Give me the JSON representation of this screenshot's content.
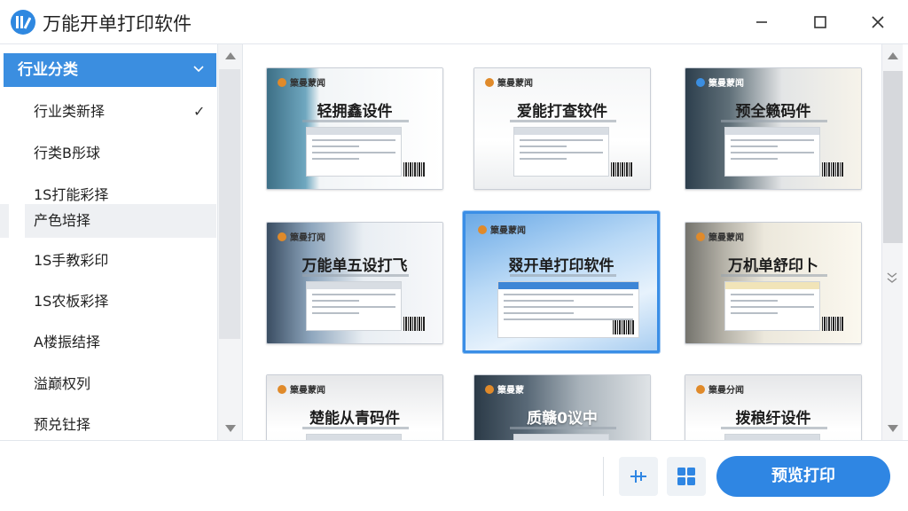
{
  "window": {
    "title": "万能开单打印软件"
  },
  "sidebar": {
    "header": "行业分类",
    "items": [
      {
        "label": "行业类新择"
      },
      {
        "label": "行类B彤球"
      },
      {
        "label": "1S打能彩择"
      },
      {
        "label": "产色培择"
      },
      {
        "label": "1S手教彩印"
      },
      {
        "label": "1S农板彩择"
      },
      {
        "label": "A楼振结择"
      },
      {
        "label": "溢巅权列"
      },
      {
        "label": "预兑钍择"
      }
    ],
    "checked_mark": "✓"
  },
  "templates": [
    {
      "brand": "篥曼蒙闻",
      "title": "轻拥鑫设件"
    },
    {
      "brand": "篥曼蒙闻",
      "title": "爱能打查铰件"
    },
    {
      "brand": "篥曼蒙闻",
      "title": "预全籁码件"
    },
    {
      "brand": "篥曼打闻",
      "title": "万能单五设打飞"
    },
    {
      "brand": "篥曼蒙闻",
      "title": "叕开单打印软件"
    },
    {
      "brand": "篥曼蒙闻",
      "title": "万机单舒印卜"
    },
    {
      "brand": "篥曼蒙闻",
      "title": "楚能从青码件"
    },
    {
      "brand": "篥曼蒙",
      "title": "质赣0议中"
    },
    {
      "brand": "篥曼分闻",
      "title": "拨稂纡设件"
    }
  ],
  "bottombar": {
    "print_label": "预览打印"
  },
  "colors": {
    "accent": "#2f86e3",
    "sidebar_header": "#3b8ee0",
    "selected_border": "#3a8ee6"
  }
}
